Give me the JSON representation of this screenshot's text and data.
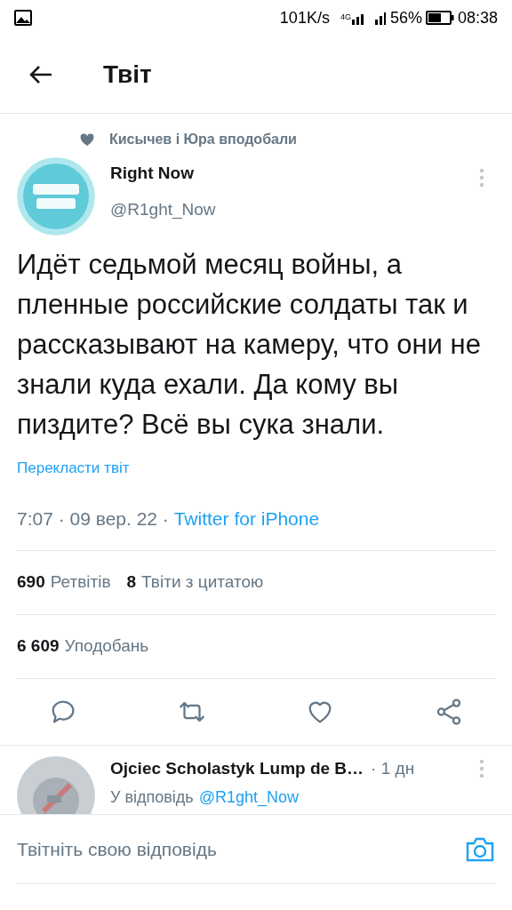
{
  "status_bar": {
    "speed": "101K/s",
    "network": "4G",
    "battery": "56%",
    "time": "08:38"
  },
  "header": {
    "title": "Твіт"
  },
  "social_context": "Кисычев і Юра вподобали",
  "tweet": {
    "name": "Right Now",
    "handle": "@R1ght_Now",
    "text": "Идёт седьмой месяц войны, а пленные российские солдаты так и рассказывают на камеру, что они не знали куда ехали. Да кому вы пиздите? Всё вы сука знали.",
    "translate": "Перекласти твіт",
    "meta": "7:07 · 09 вер. 22 · ",
    "source": "Twitter for iPhone"
  },
  "stats": [
    {
      "count": "690",
      "label": "Ретвітів"
    },
    {
      "count": "8",
      "label": "Твіти з цитатою"
    }
  ],
  "likes": {
    "count": "6 609",
    "label": "Уподобань"
  },
  "actions": [
    {
      "kind": "reply"
    },
    {
      "kind": "retweet"
    },
    {
      "kind": "like"
    },
    {
      "kind": "share"
    }
  ],
  "reply": {
    "name": "Ojciec Scholastyk Lump de B…",
    "time": "· 1 дн",
    "prefix": "У відповідь",
    "mention": "@R1ght_Now"
  },
  "composer": {
    "placeholder": "Твітніть свою відповідь"
  }
}
